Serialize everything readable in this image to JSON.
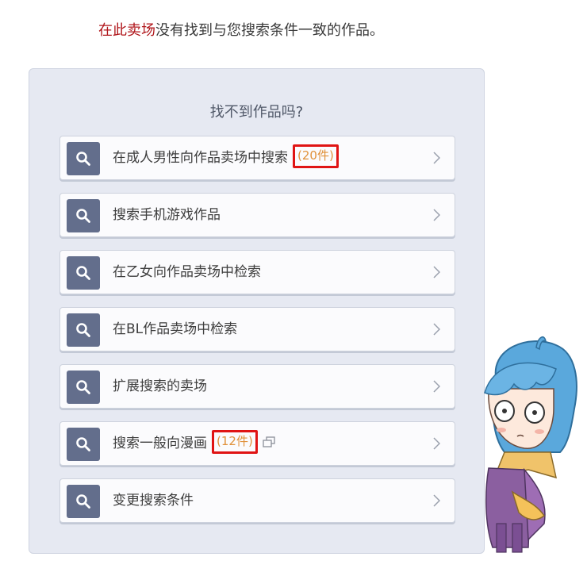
{
  "notice": {
    "highlight": "在此卖场",
    "rest": "没有找到与您搜索条件一致的作品。"
  },
  "panel": {
    "title": "找不到作品吗?",
    "items": [
      {
        "label": "在成人男性向作品卖场中搜索",
        "count": "(20件)"
      },
      {
        "label": "搜索手机游戏作品"
      },
      {
        "label": "在乙女向作品卖场中检索"
      },
      {
        "label": "在BL作品卖场中检索"
      },
      {
        "label": "扩展搜索的卖场"
      },
      {
        "label": "搜索一般向漫画",
        "count": "(12件)"
      },
      {
        "label": "变更搜索条件"
      }
    ]
  },
  "colors": {
    "accent": "#b0161b",
    "count": "#e0913a",
    "highlight_box": "#e01414",
    "search_button": "#636e8c",
    "panel_bg": "#e6e9f2"
  },
  "icons": {
    "row_icon": "search-icon",
    "row_arrow": "chevron-right-icon",
    "external": "external-link-icon"
  }
}
